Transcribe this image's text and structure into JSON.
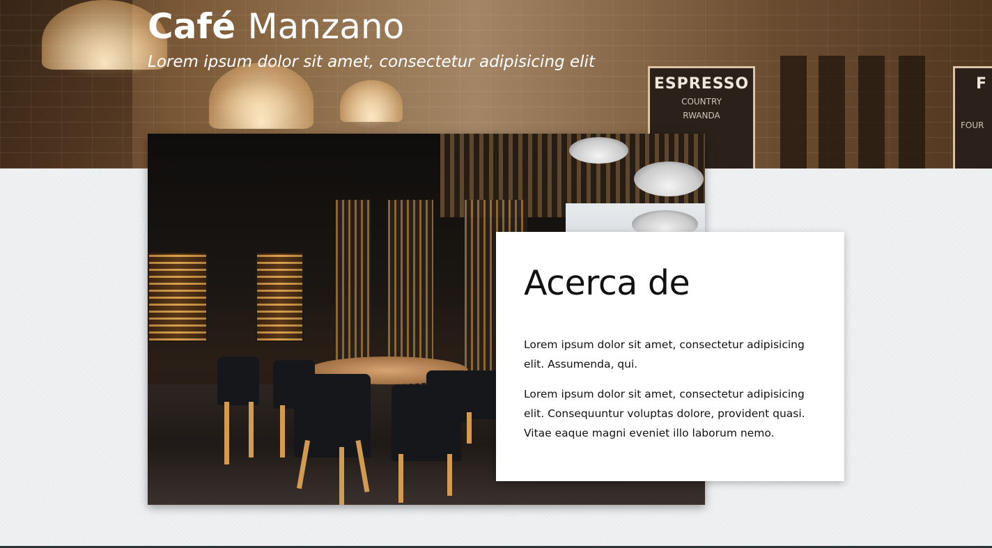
{
  "header": {
    "title_strong": "Café",
    "title_light": "Manzano",
    "tagline": "Lorem ipsum dolor sit amet, consectetur adipisicing elit",
    "board_text": "ESPRESSO",
    "board_subtext": "COUNTRY",
    "board_line": "RWANDA",
    "board2_text": "F",
    "board2_subtext": "FOUR"
  },
  "about": {
    "title": "Acerca de",
    "paragraphs": [
      "Lorem ipsum dolor sit amet, consectetur adipisicing elit. Assumenda, qui.",
      "Lorem ipsum dolor sit amet, consectetur adipisicing elit. Consequuntur voluptas dolore, provident quasi. Vitae eaque magni eveniet illo laborum nemo."
    ]
  },
  "colors": {
    "text_dark": "#111111",
    "page_bg": "#eef0f2",
    "card_bg": "#ffffff",
    "footer_bar": "#2d3438"
  }
}
